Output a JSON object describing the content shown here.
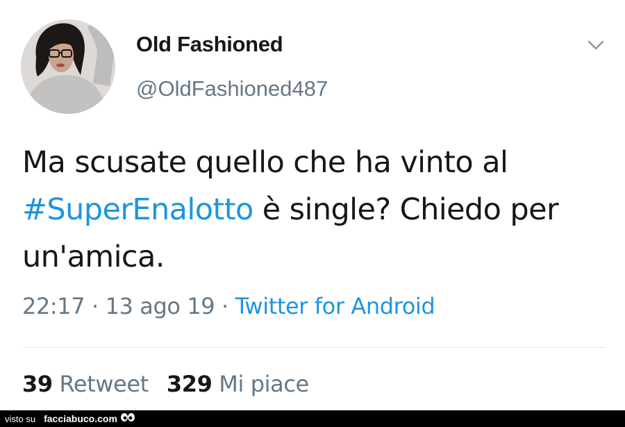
{
  "tweet": {
    "display_name": "Old Fashioned",
    "handle": "@OldFashioned487",
    "text_part1": "Ma scusate quello che ha vinto al",
    "hashtag": "#SuperEnalotto",
    "text_part2": " è single? Chiedo per un'amica.",
    "time": "22:17",
    "date": "13 ago 19",
    "separator": " · ",
    "source": "Twitter for Android",
    "retweet_count": "39",
    "retweet_label": "Retweet",
    "like_count": "329",
    "like_label": "Mi piace"
  },
  "footer": {
    "seen_label": "visto su",
    "brand": "facciabuco.com"
  },
  "colors": {
    "link": "#1b95e0",
    "text": "#14171a",
    "muted": "#657786",
    "divider": "#e1e8ed"
  },
  "icons": {
    "menu": "chevron-down-icon",
    "brand": "eyes-logo-icon"
  }
}
